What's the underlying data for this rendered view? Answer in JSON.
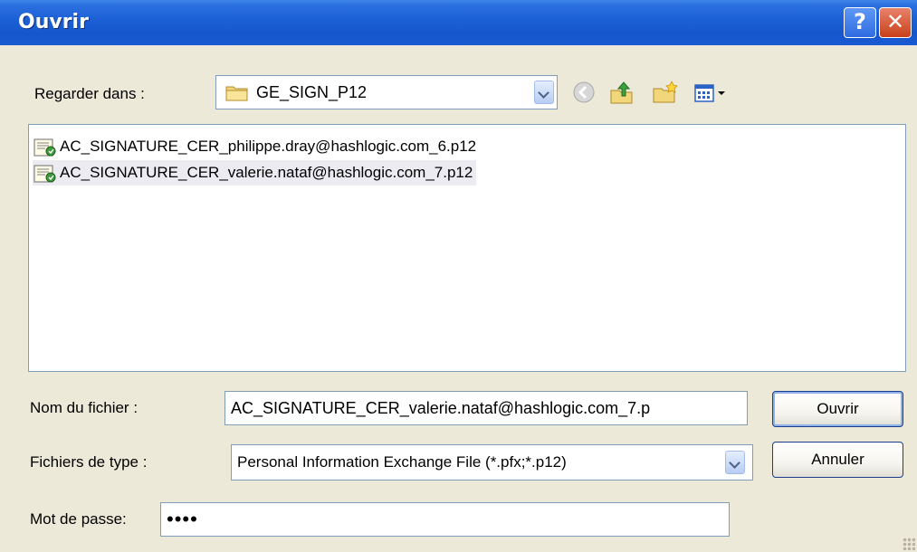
{
  "window": {
    "title": "Ouvrir",
    "help_glyph": "?",
    "close_glyph": "✕"
  },
  "lookin": {
    "label": "Regarder dans :",
    "value": "GE_SIGN_P12"
  },
  "toolbar": {
    "icons": [
      "back-icon",
      "up-folder-icon",
      "new-folder-icon",
      "view-menu-icon"
    ]
  },
  "files": [
    {
      "name": "AC_SIGNATURE_CER_philippe.dray@hashlogic.com_6.p12",
      "selected": false
    },
    {
      "name": "AC_SIGNATURE_CER_valerie.nataf@hashlogic.com_7.p12",
      "selected": true
    }
  ],
  "filename": {
    "label": "Nom du fichier :",
    "value": "AC_SIGNATURE_CER_valerie.nataf@hashlogic.com_7.p"
  },
  "filetype": {
    "label": "Fichiers de type :",
    "value": "Personal Information Exchange File (*.pfx;*.p12)"
  },
  "password": {
    "label": "Mot de passe:",
    "value": "••••"
  },
  "buttons": {
    "open": "Ouvrir",
    "cancel": "Annuler"
  },
  "colors": {
    "titlebar": "#1c5fd6",
    "dialog_bg": "#ECE9D8",
    "selected_row": "#ecebf2",
    "field_border": "#7f9db9"
  }
}
